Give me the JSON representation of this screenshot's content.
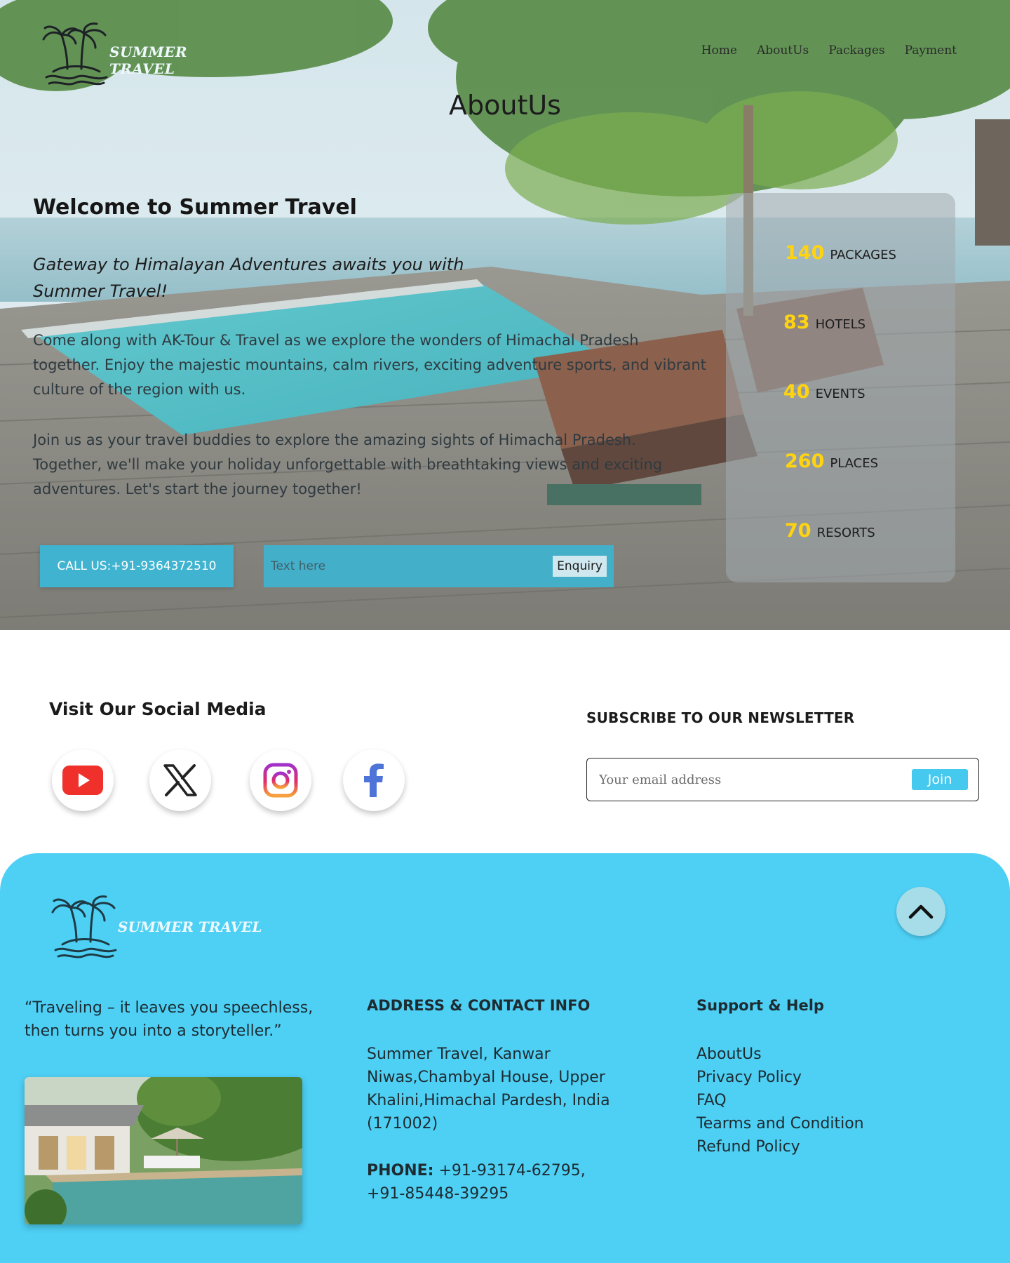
{
  "brand": {
    "name": "SUMMER TRAVEL"
  },
  "nav": {
    "items": [
      "Home",
      "AboutUs",
      "Packages",
      "Payment"
    ]
  },
  "hero": {
    "page_title": "AboutUs",
    "welcome": "Welcome to Summer Travel",
    "tagline": "Gateway to Himalayan Adventures awaits you with Summer Travel!",
    "paragraph1": "Come along with AK-Tour & Travel as we explore the wonders of Himachal Pradesh together. Enjoy the majestic mountains, calm rivers, exciting adventure sports, and vibrant culture of the region with us.",
    "paragraph2": "Join us as your travel buddies to explore the amazing sights of Himachal Pradesh. Together, we'll make your holiday unforgettable with breathtaking views and exciting adventures. Let's start the journey together!",
    "call_button": "CALL US:+91-9364372510",
    "enquiry_placeholder": "Text here",
    "enquiry_button": "Enquiry"
  },
  "stats": [
    {
      "number": "140",
      "label": "PACKAGES"
    },
    {
      "number": "83",
      "label": "HOTELS"
    },
    {
      "number": "40",
      "label": "EVENTS"
    },
    {
      "number": "260",
      "label": "PLACES"
    },
    {
      "number": "70",
      "label": "RESORTS"
    }
  ],
  "social": {
    "title": "Visit Our Social Media",
    "icons": [
      "youtube-icon",
      "x-icon",
      "instagram-icon",
      "facebook-icon"
    ]
  },
  "newsletter": {
    "title": "SUBSCRIBE TO OUR NEWSLETTER",
    "placeholder": "Your email address",
    "button": "Join"
  },
  "footer": {
    "quote": "“Traveling – it leaves you speechless,\n then turns you into a storyteller.”",
    "address_heading": "ADDRESS & CONTACT INFO",
    "address": "Summer Travel, Kanwar Niwas,Chambyal House, Upper Khalini,Himachal Pardesh, India (171002)",
    "phone_label": "PHONE:",
    "phone_value": " +91-93174-62795, +91-85448-39295",
    "support_heading": "Support & Help",
    "support_links": [
      "AboutUs",
      "Privacy Policy",
      "FAQ",
      "Tearms and Condition",
      "Refund Policy"
    ]
  },
  "colors": {
    "accent": "#3fb3cf",
    "footer_bg": "#4ed0f5",
    "stat_number": "#ffd40f",
    "join_button": "#45c9ef"
  }
}
